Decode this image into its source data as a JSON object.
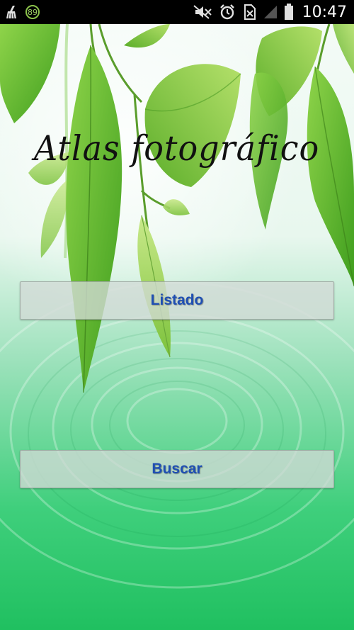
{
  "status_bar": {
    "time": "10:47",
    "badge_number": "89",
    "left_icons": [
      "broom-icon",
      "badge-89-icon"
    ],
    "right_icons": [
      "mute-icon",
      "alarm-icon",
      "no-sim-icon",
      "signal-icon",
      "battery-icon"
    ]
  },
  "app": {
    "title": "Atlas fotográfico",
    "buttons": {
      "listado": "Listado",
      "buscar": "Buscar"
    }
  },
  "colors": {
    "button_text": "#1f4fb3",
    "background_green": "#2ecc71",
    "status_bar": "#000000"
  }
}
